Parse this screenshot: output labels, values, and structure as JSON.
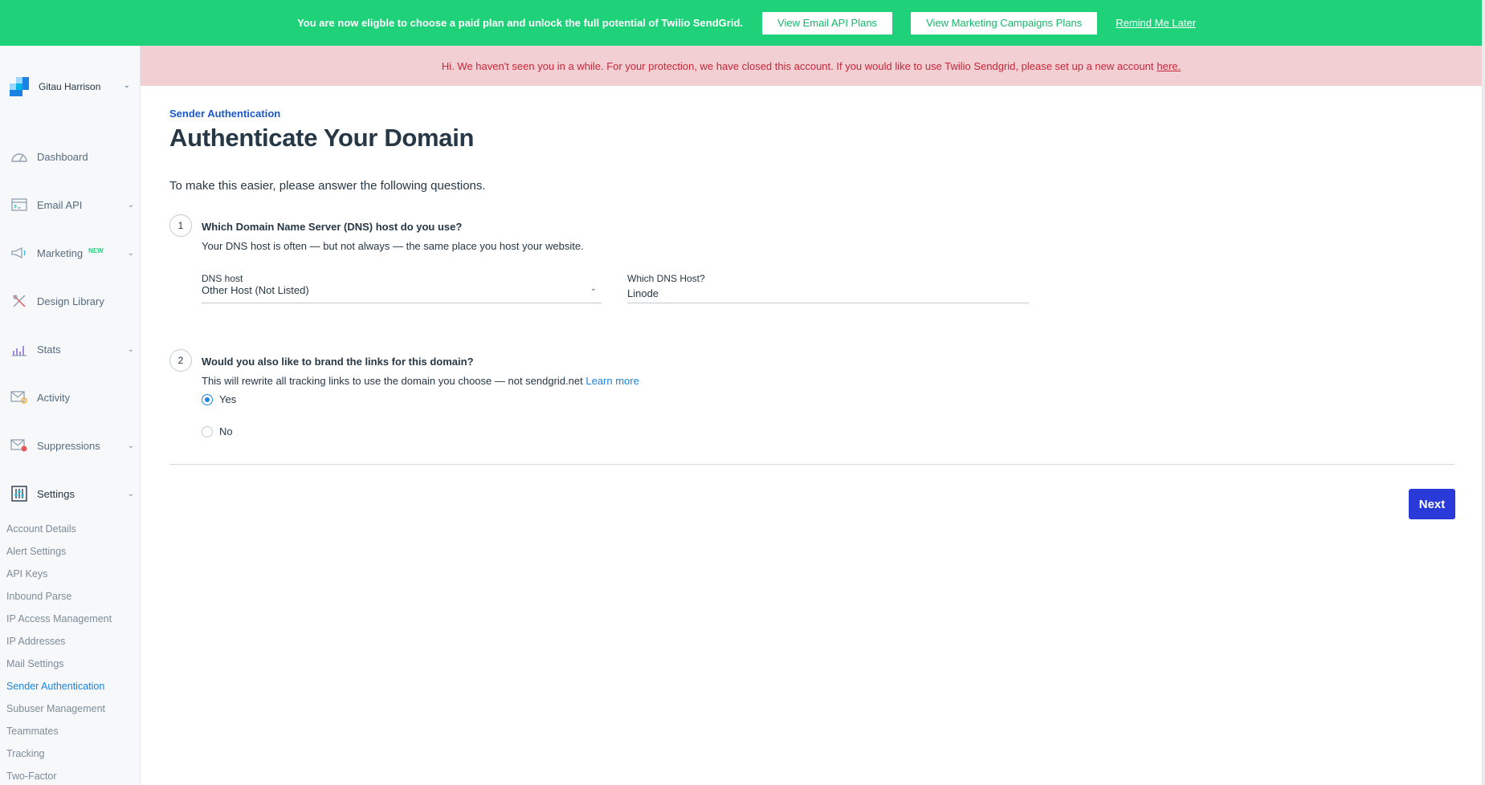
{
  "banner": {
    "message": "You are now eligble to choose a paid plan and unlock the full potential of Twilio SendGrid.",
    "email_api_plans": "View Email API Plans",
    "marketing_plans": "View Marketing Campaigns Plans",
    "remind_later": "Remind Me Later",
    "bg_color": "#1fd27a"
  },
  "alert": {
    "message": "Hi. We haven't seen you in a while. For your protection, we have closed this account. If you would like to use Twilio Sendgrid, please set up a new account",
    "link": "here.",
    "bg_color": "#f2cfd2",
    "text_color": "#c5273b"
  },
  "account": {
    "name": "Gitau Harrison"
  },
  "sidebar": {
    "items": [
      {
        "label": "Dashboard",
        "icon": "dashboard-icon"
      },
      {
        "label": "Email API",
        "icon": "email-api-icon"
      },
      {
        "label": "Marketing",
        "icon": "megaphone-icon",
        "badge": "NEW"
      },
      {
        "label": "Design Library",
        "icon": "design-library-icon"
      },
      {
        "label": "Stats",
        "icon": "stats-icon"
      },
      {
        "label": "Activity",
        "icon": "activity-icon"
      },
      {
        "label": "Suppressions",
        "icon": "suppressions-icon"
      },
      {
        "label": "Settings",
        "icon": "settings-icon"
      }
    ],
    "settings_sub": [
      "Account Details",
      "Alert Settings",
      "API Keys",
      "Inbound Parse",
      "IP Access Management",
      "IP Addresses",
      "Mail Settings",
      "Sender Authentication",
      "Subuser Management",
      "Teammates",
      "Tracking",
      "Two-Factor"
    ],
    "active_sub": "Sender Authentication"
  },
  "main": {
    "eyebrow": "Sender Authentication",
    "title": "Authenticate Your Domain",
    "intro": "To make this easier, please answer the following questions.",
    "q1": {
      "number": "1",
      "title": "Which Domain Name Server (DNS) host do you use?",
      "desc": "Your DNS host is often — but not always — the same place you host your website.",
      "dns_host_label": "DNS host",
      "dns_host_value": "Other Host (Not Listed)",
      "which_host_label": "Which DNS Host?",
      "which_host_value": "Linode"
    },
    "q2": {
      "number": "2",
      "title": "Would you also like to brand the links for this domain?",
      "desc": "This will rewrite all tracking links to use the domain you choose — not sendgrid.net",
      "learn_more": "Learn more",
      "option_yes": "Yes",
      "option_no": "No",
      "selected": "Yes"
    },
    "next": "Next",
    "accent_color": "#2a3ad9"
  }
}
